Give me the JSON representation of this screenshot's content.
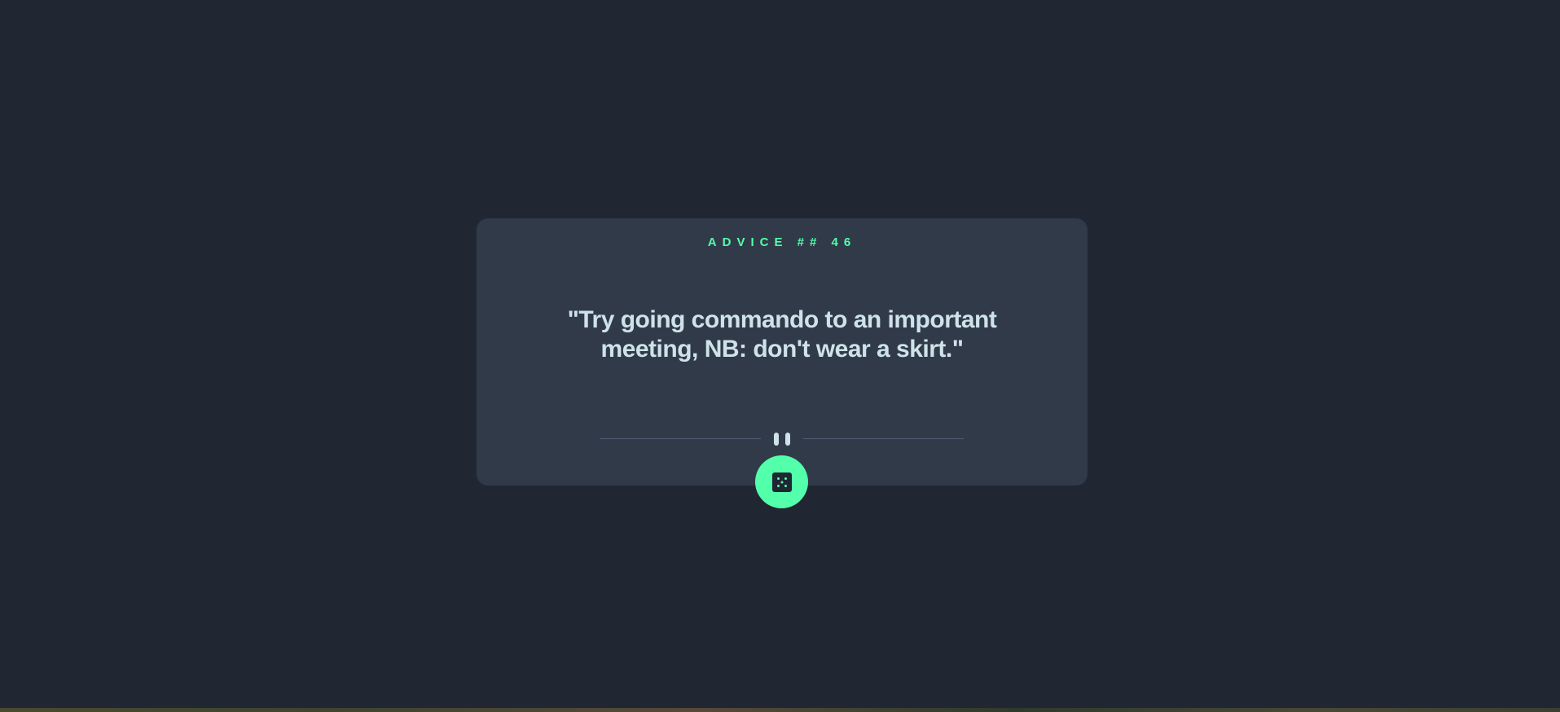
{
  "advice": {
    "label": "ADVICE ## 46",
    "text": "\"Try going commando to an important meeting, NB: don't wear a skirt.\""
  },
  "divider": {
    "icon": "pause-icon"
  },
  "button": {
    "icon": "dice-icon",
    "aria_label": "Generate new advice"
  },
  "colors": {
    "background": "#202632",
    "card": "#313a49",
    "accent": "#53ffaa",
    "text": "#cee3e9",
    "divider": "#4f5d74"
  }
}
